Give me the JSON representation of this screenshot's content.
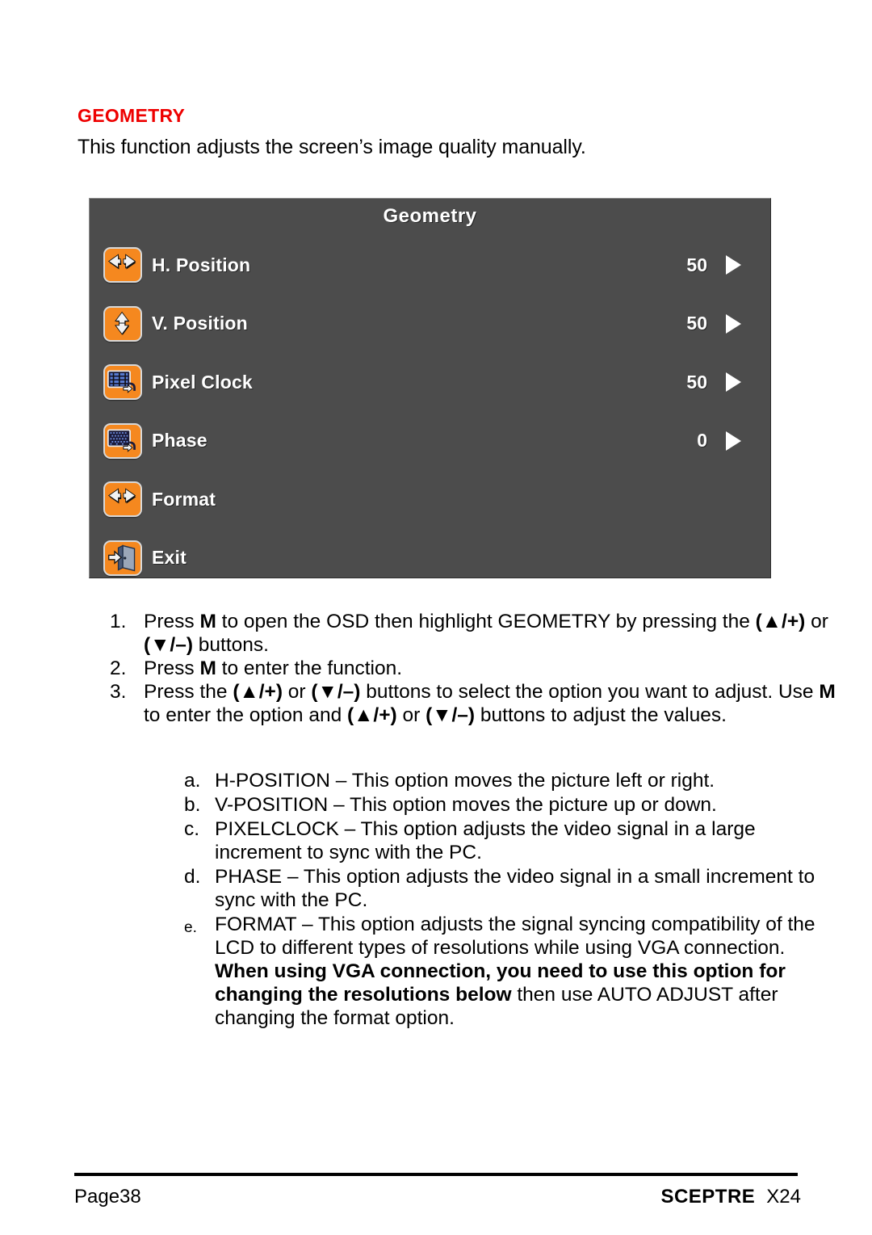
{
  "document": {
    "section_title": "GEOMETRY",
    "intro": "This function adjusts the screen’s image quality manually."
  },
  "osd": {
    "title": "Geometry",
    "accent_color": "#f5881f",
    "panel_color": "#4c4c4c",
    "rows": [
      {
        "icon": "horizontal-arrows-icon",
        "label": "H. Position",
        "value": "50",
        "arrow": "▶"
      },
      {
        "icon": "vertical-arrows-icon",
        "label": "V. Position",
        "value": "50",
        "arrow": "▶"
      },
      {
        "icon": "pixel-clock-monitor-icon",
        "label": "Pixel Clock",
        "value": "50",
        "arrow": "▶"
      },
      {
        "icon": "phase-monitor-icon",
        "label": "Phase",
        "value": "0",
        "arrow": "▶"
      },
      {
        "icon": "horizontal-arrows-icon",
        "label": "Format",
        "value": "",
        "arrow": ""
      },
      {
        "icon": "exit-door-icon",
        "label": "Exit",
        "value": "",
        "arrow": ""
      }
    ]
  },
  "steps": [
    {
      "num": "1.",
      "parts": [
        {
          "text": "Press ",
          "bold": false
        },
        {
          "text": "M",
          "bold": true
        },
        {
          "text": " to open the OSD then highlight GEOMETRY by pressing the ",
          "bold": false
        },
        {
          "text": "(▲/+)",
          "bold": true
        },
        {
          "text": " or ",
          "bold": false
        },
        {
          "text": "(▼/–)",
          "bold": true
        },
        {
          "text": " buttons.",
          "bold": false
        }
      ]
    },
    {
      "num": "2.",
      "parts": [
        {
          "text": "Press ",
          "bold": false
        },
        {
          "text": "M",
          "bold": true
        },
        {
          "text": " to enter the function.",
          "bold": false
        }
      ]
    },
    {
      "num": "3.",
      "parts": [
        {
          "text": "Press the ",
          "bold": false
        },
        {
          "text": "(▲/+)",
          "bold": true
        },
        {
          "text": " or ",
          "bold": false
        },
        {
          "text": "(▼/–)",
          "bold": true
        },
        {
          "text": " buttons to select the option you want to adjust. Use ",
          "bold": false
        },
        {
          "text": "M",
          "bold": true
        },
        {
          "text": " to enter the option and ",
          "bold": false
        },
        {
          "text": "(▲/+)",
          "bold": true
        },
        {
          "text": " or ",
          "bold": false
        },
        {
          "text": "(▼/–)",
          "bold": true
        },
        {
          "text": " buttons to adjust the values.",
          "bold": false
        }
      ]
    }
  ],
  "substeps": [
    {
      "num": "a.",
      "small_marker": false,
      "parts": [
        {
          "text": "H-POSITION – This option moves the picture left or right.",
          "bold": false
        }
      ]
    },
    {
      "num": "b.",
      "small_marker": false,
      "parts": [
        {
          "text": "V-POSITION – This option moves the picture up or down.",
          "bold": false
        }
      ]
    },
    {
      "num": "c.",
      "small_marker": false,
      "parts": [
        {
          "text": "PIXELCLOCK – This option adjusts the video signal in a large increment to sync with the PC.",
          "bold": false
        }
      ]
    },
    {
      "num": "d.",
      "small_marker": false,
      "parts": [
        {
          "text": "PHASE – This option adjusts the video signal in a small increment to sync with the PC.",
          "bold": false
        }
      ]
    },
    {
      "num": "e.",
      "small_marker": true,
      "parts": [
        {
          "text": "FORMAT – This option adjusts the signal syncing compatibility of the LCD to different types of resolutions while using VGA connection. ",
          "bold": false
        },
        {
          "text": "When using VGA connection, you need to use this option for changing the resolutions below",
          "bold": true
        },
        {
          "text": " then use AUTO ADJUST after changing the format option.",
          "bold": false
        }
      ]
    }
  ],
  "footer": {
    "page": "Page38",
    "brand": "SCEPTRE",
    "model": "X24"
  }
}
